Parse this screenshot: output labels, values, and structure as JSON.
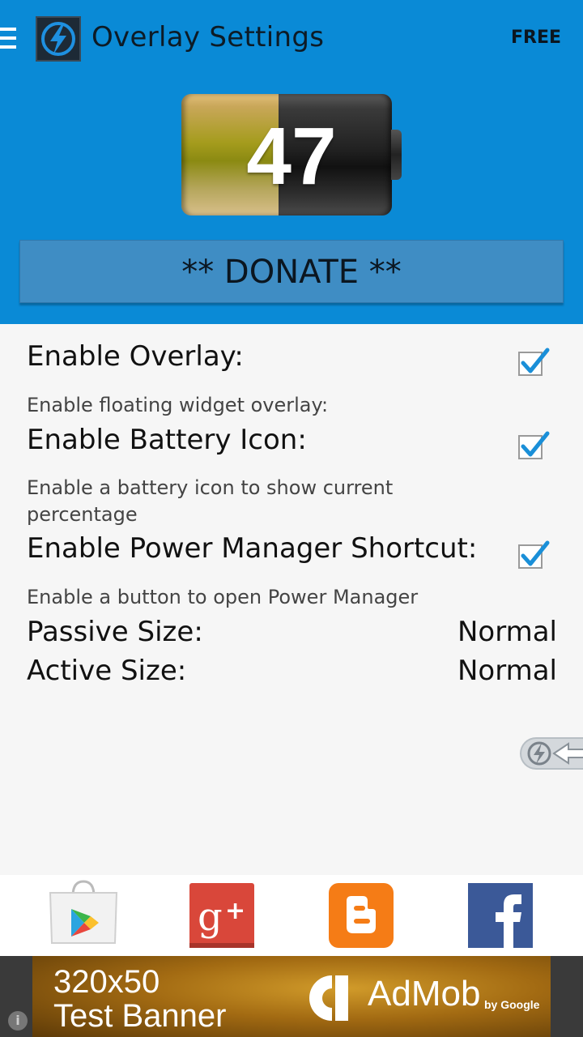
{
  "header": {
    "title": "Overlay Settings",
    "free_label": "FREE",
    "battery_level": "47",
    "donate_label": "** DONATE **"
  },
  "settings": [
    {
      "title": "Enable Overlay:",
      "summary": "Enable floating widget overlay:",
      "checked": true
    },
    {
      "title": "Enable Battery Icon:",
      "summary": "Enable a battery icon to show current percentage",
      "checked": true
    },
    {
      "title": "Enable Power Manager Shortcut:",
      "summary": "Enable a button to open Power Manager",
      "checked": true
    }
  ],
  "sizes": [
    {
      "label": "Passive Size:",
      "value": "Normal"
    },
    {
      "label": "Active Size:",
      "value": "Normal"
    }
  ],
  "social": [
    "play-store-icon",
    "google-plus-icon",
    "blogger-icon",
    "facebook-icon"
  ],
  "ad": {
    "line1": "320x50",
    "line2": "Test Banner",
    "brand": "AdMob",
    "byline": "by Google"
  },
  "colors": {
    "header_bg": "#0a8ad6",
    "donate_bg": "#3f8dc4",
    "checkmark": "#1a8fd8"
  }
}
